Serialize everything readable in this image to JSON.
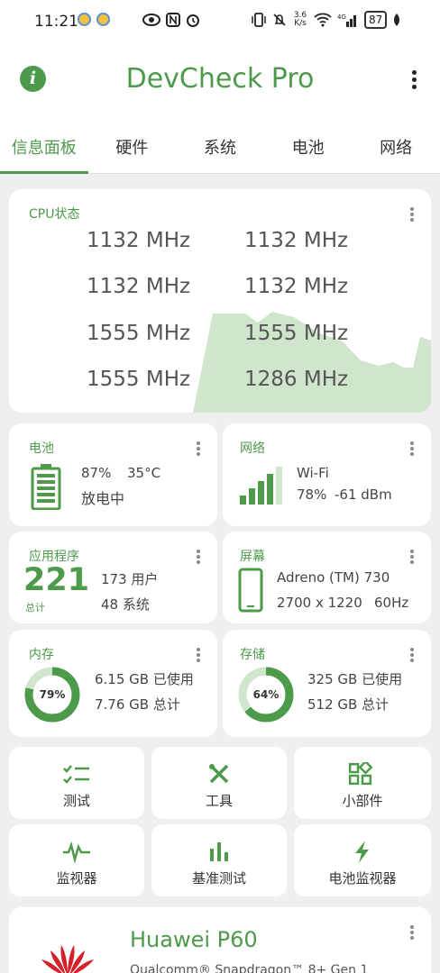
{
  "status_bar": {
    "time": "11:21",
    "network_speed": "3.6 K/s",
    "battery_level": "87"
  },
  "header": {
    "title": "DevCheck Pro",
    "info_icon": "i"
  },
  "tabs": [
    {
      "label": "信息面板",
      "active": true
    },
    {
      "label": "硬件",
      "active": false
    },
    {
      "label": "系统",
      "active": false
    },
    {
      "label": "电池",
      "active": false
    },
    {
      "label": "网络",
      "active": false
    }
  ],
  "cpu": {
    "title": "CPU状态",
    "cores": [
      "1132 MHz",
      "1132 MHz",
      "1132 MHz",
      "1132 MHz",
      "1555 MHz",
      "1555 MHz",
      "1555 MHz",
      "1286 MHz"
    ]
  },
  "battery": {
    "title": "电池",
    "percent": "87%",
    "temp": "35°C",
    "status": "放电中",
    "level": 0.87
  },
  "network": {
    "title": "网络",
    "type": "Wi-Fi",
    "percent": "78%",
    "signal": "-61 dBm"
  },
  "apps": {
    "title": "应用程序",
    "total": "221",
    "total_label": "总计",
    "user": "173 用户",
    "system": "48 系统"
  },
  "screen": {
    "title": "屏幕",
    "gpu": "Adreno (TM) 730",
    "resolution": "2700 x 1220",
    "refresh": "60Hz"
  },
  "memory": {
    "title": "内存",
    "percent": "79%",
    "fraction": 0.79,
    "used": "6.15 GB 已使用",
    "total": "7.76 GB 总计"
  },
  "storage": {
    "title": "存储",
    "percent": "64%",
    "fraction": 0.64,
    "used": "325 GB 已使用",
    "total": "512 GB 总计"
  },
  "tools": [
    {
      "label": "测试",
      "icon": "checklist-icon"
    },
    {
      "label": "工具",
      "icon": "tools-icon"
    },
    {
      "label": "小部件",
      "icon": "widgets-icon"
    },
    {
      "label": "监视器",
      "icon": "pulse-icon"
    },
    {
      "label": "基准测试",
      "icon": "bar-chart-icon"
    },
    {
      "label": "电池监视器",
      "icon": "bolt-icon"
    }
  ],
  "device": {
    "name": "Huawei P60",
    "chip": "Qualcomm® Snapdragon™ 8+ Gen 1"
  },
  "colors": {
    "accent": "#4c9a4a",
    "graph_fill": "#cfe5cc",
    "background": "#efefef"
  }
}
